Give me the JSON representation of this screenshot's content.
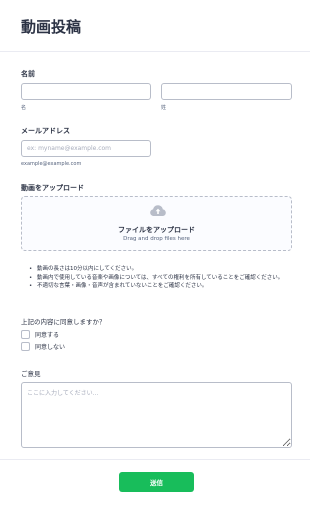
{
  "form": {
    "title": "動画投稿"
  },
  "name_field": {
    "label": "名前",
    "first_value": "",
    "last_value": "",
    "first_sublabel": "名",
    "last_sublabel": "姓"
  },
  "email_field": {
    "label": "メールアドレス",
    "placeholder": "ex: myname@example.com",
    "value": "",
    "sublabel": "example@example.com"
  },
  "upload_field": {
    "label": "動画をアップロード",
    "icon": "cloud-upload-icon",
    "title": "ファイルをアップロード",
    "subtitle": "Drag and drop files here"
  },
  "notes": [
    "動画の長さは10分以内にしてください。",
    "動画内で使用している音楽や画像については、すべての権利を所有していることをご確認ください。",
    "不適切な言葉・画像・音声が含まれていないことをご確認ください。"
  ],
  "consent": {
    "question": "上記の内容に同意しますか？",
    "options": [
      "同意する",
      "同意しない"
    ]
  },
  "comment_field": {
    "label": "ご意見",
    "placeholder": "ここに入力してください...",
    "value": ""
  },
  "submit": {
    "label": "送信"
  },
  "colors": {
    "accent": "#18bd5b",
    "text": "#2c3345",
    "border": "#b8bdc9"
  }
}
